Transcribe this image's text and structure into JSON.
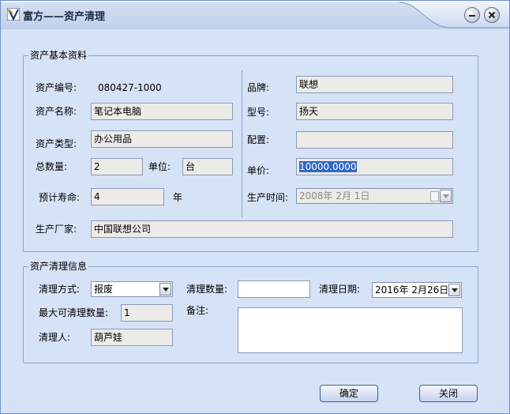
{
  "window": {
    "title": "富方——资产清理"
  },
  "basic_info": {
    "group_title": "资产基本资料",
    "asset_no_label": "资产编号:",
    "asset_no_value": "080427-1000",
    "asset_name_label": "资产名称:",
    "asset_name_value": "笔记本电脑",
    "asset_type_label": "资产类型:",
    "asset_type_value": "办公用品",
    "total_qty_label": "总数量:",
    "total_qty_value": "2",
    "unit_label": "单位:",
    "unit_value": "台",
    "life_label": "预计寿命:",
    "life_value": "4",
    "life_unit": "年",
    "brand_label": "品牌:",
    "brand_value": "联想",
    "model_label": "型号:",
    "model_value": "扬天",
    "config_label": "配置:",
    "config_value": "",
    "price_label": "单价:",
    "price_value": "10000.0000",
    "prod_date_label": "生产时间:",
    "prod_date_value": "2008年 2月 1日",
    "maker_label": "生产厂家:",
    "maker_value": "中国联想公司"
  },
  "cleanup": {
    "group_title": "资产清理信息",
    "method_label": "清理方式:",
    "method_value": "报废",
    "qty_label": "清理数量:",
    "qty_value": "",
    "date_label": "清理日期:",
    "date_value": "2016年 2月26日",
    "max_qty_label": "最大可清理数量:",
    "max_qty_value": "1",
    "remark_label": "备注:",
    "remark_value": "",
    "person_label": "清理人:",
    "person_value": "葫芦娃"
  },
  "buttons": {
    "ok": "确定",
    "close": "关闭"
  },
  "colors": {
    "window_bg": "#d6e2f6",
    "selection": "#3168c6",
    "border": "#8ea3c7"
  }
}
